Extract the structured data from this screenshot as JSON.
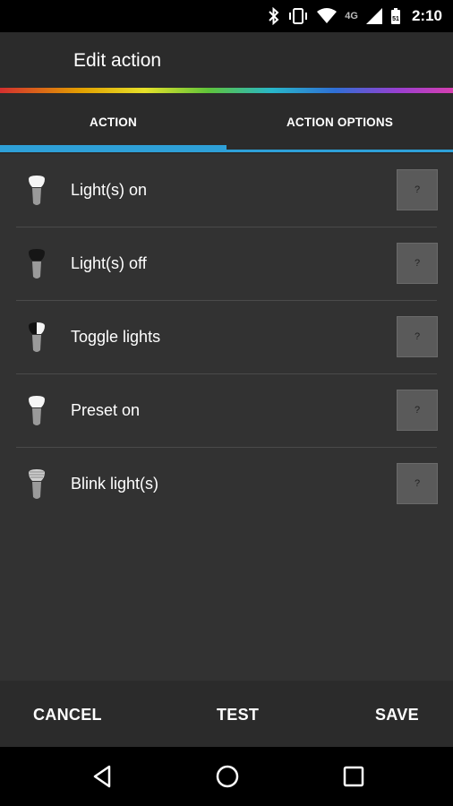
{
  "status_bar": {
    "time": "2:10",
    "network_label": "4G",
    "icons": [
      "bluetooth-icon",
      "vibrate-icon",
      "wifi-icon",
      "4g-icon",
      "signal-icon",
      "battery-icon"
    ]
  },
  "app_bar": {
    "title": "Edit action"
  },
  "tabs": [
    {
      "label": "ACTION",
      "selected": true
    },
    {
      "label": "ACTION OPTIONS",
      "selected": false
    }
  ],
  "actions": [
    {
      "label": "Light(s) on",
      "icon": "bulb-on-icon",
      "help": "?"
    },
    {
      "label": "Light(s) off",
      "icon": "bulb-off-icon",
      "help": "?"
    },
    {
      "label": "Toggle lights",
      "icon": "bulb-toggle-icon",
      "help": "?"
    },
    {
      "label": "Preset on",
      "icon": "bulb-preset-icon",
      "help": "?"
    },
    {
      "label": "Blink light(s)",
      "icon": "bulb-blink-icon",
      "help": "?"
    }
  ],
  "bottom_bar": {
    "cancel": "CANCEL",
    "test": "TEST",
    "save": "SAVE"
  },
  "nav_bar": {
    "icons": [
      "back-icon",
      "home-icon",
      "recents-icon"
    ]
  },
  "colors": {
    "accent": "#2ea0d8",
    "background": "#323232",
    "toolbar": "#2b2b2b",
    "button": "#5a5a5a"
  }
}
